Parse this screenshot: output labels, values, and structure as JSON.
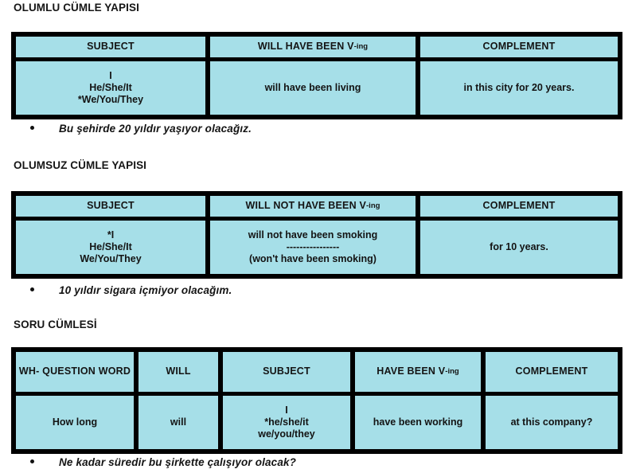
{
  "document": {
    "language": "Turkish / English",
    "topic": "Future Perfect Continuous Tense"
  },
  "sections": [
    {
      "id": "affirmative",
      "title": "OLUMLU CÜMLE YAPISI",
      "table": {
        "columns": 3,
        "headers": [
          {
            "text": "SUBJECT",
            "sub": ""
          },
          {
            "text": "WILL HAVE BEEN V",
            "sub": "-ing"
          },
          {
            "text": "COMPLEMENT",
            "sub": ""
          }
        ],
        "row": [
          {
            "lines": [
              "I",
              "He/She/It",
              "*We/You/They"
            ]
          },
          {
            "lines": [
              "will have been living"
            ]
          },
          {
            "lines": [
              "in this city for 20 years."
            ]
          }
        ]
      },
      "example": "Bu şehirde 20 yıldır yaşıyor olacağız."
    },
    {
      "id": "negative",
      "title": "OLUMSUZ CÜMLE YAPISI",
      "table": {
        "columns": 3,
        "headers": [
          {
            "text": "SUBJECT",
            "sub": ""
          },
          {
            "text": "WILL NOT HAVE BEEN V",
            "sub": "-ing"
          },
          {
            "text": "COMPLEMENT",
            "sub": ""
          }
        ],
        "row": [
          {
            "lines": [
              "*I",
              "He/She/It",
              "We/You/They"
            ]
          },
          {
            "lines": [
              "will not have been smoking",
              "----------------",
              "(won't have been smoking)"
            ]
          },
          {
            "lines": [
              "for 10 years."
            ]
          }
        ]
      },
      "example": "10 yıldır sigara içmiyor olacağım."
    },
    {
      "id": "question",
      "title": "SORU CÜMLESİ",
      "table": {
        "columns": 5,
        "headers": [
          {
            "text": "WH- QUESTION WORD",
            "sub": ""
          },
          {
            "text": "WILL",
            "sub": ""
          },
          {
            "text": "SUBJECT",
            "sub": ""
          },
          {
            "text": "HAVE BEEN V",
            "sub": "-ing"
          },
          {
            "text": "COMPLEMENT",
            "sub": ""
          }
        ],
        "row": [
          {
            "lines": [
              "How long"
            ]
          },
          {
            "lines": [
              "will"
            ]
          },
          {
            "lines": [
              "I",
              "*he/she/it",
              "we/you/they"
            ]
          },
          {
            "lines": [
              "have been working"
            ]
          },
          {
            "lines": [
              "at this company?"
            ]
          }
        ]
      },
      "example": "Ne kadar süredir bu şirkette çalışıyor olacak?"
    }
  ],
  "colors": {
    "cell_fill": "#a6dfe8",
    "border": "#000000",
    "text": "#141414",
    "page_background": "#ffffff"
  }
}
